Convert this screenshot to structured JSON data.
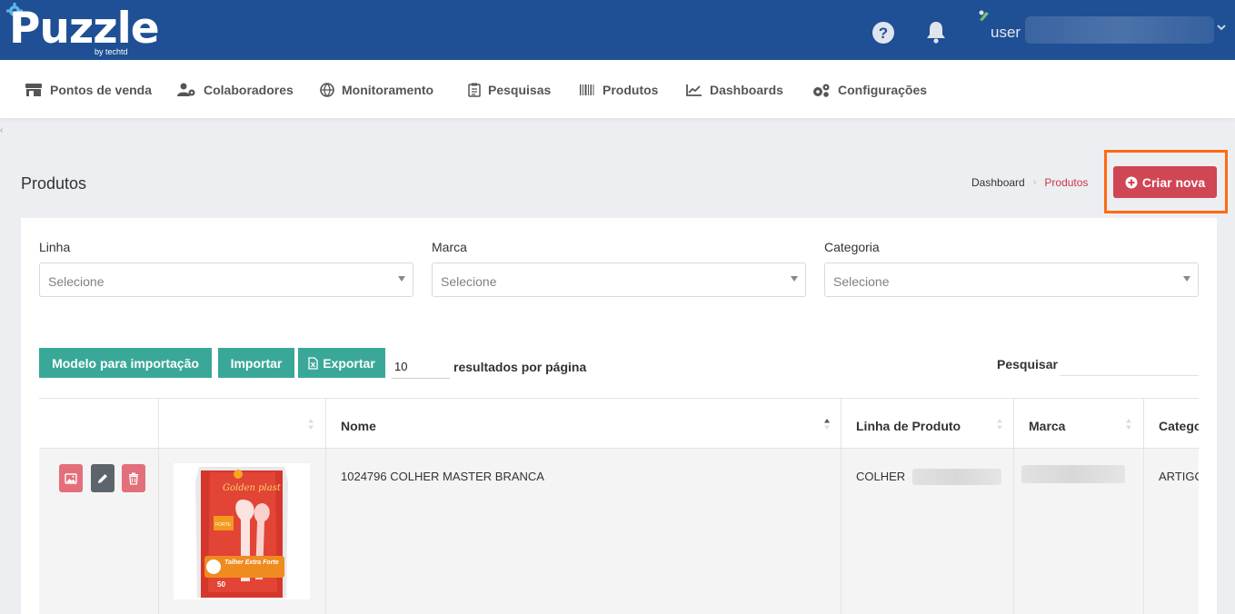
{
  "header": {
    "logo_text": "Puzzle",
    "logo_sub": "by techtd",
    "user_label": "user",
    "colors": {
      "bar": "#1f4f94"
    }
  },
  "nav": {
    "items": [
      {
        "label": "Pontos de venda",
        "icon": "store-icon"
      },
      {
        "label": "Colaboradores",
        "icon": "users-icon"
      },
      {
        "label": "Monitoramento",
        "icon": "globe-icon"
      },
      {
        "label": "Pesquisas",
        "icon": "clipboard-icon"
      },
      {
        "label": "Produtos",
        "icon": "barcode-icon"
      },
      {
        "label": "Dashboards",
        "icon": "chart-line-icon"
      },
      {
        "label": "Configurações",
        "icon": "gears-icon"
      }
    ]
  },
  "page": {
    "title": "Produtos",
    "breadcrumb": {
      "home": "Dashboard",
      "current": "Produtos"
    },
    "create_button": "Criar nova",
    "colors": {
      "accent": "#cf4654",
      "highlight": "#ff6a13",
      "teal": "#3aa898"
    }
  },
  "filters": [
    {
      "label": "Linha",
      "placeholder": "Selecione"
    },
    {
      "label": "Marca",
      "placeholder": "Selecione"
    },
    {
      "label": "Categoria",
      "placeholder": "Selecione"
    }
  ],
  "toolbar": {
    "template_button": "Modelo para importação",
    "import_button": "Importar",
    "export_button": "Exportar",
    "page_length": "10",
    "page_length_label": "resultados por página",
    "search_label": "Pesquisar"
  },
  "table": {
    "columns": [
      "",
      "",
      "Nome",
      "Linha de Produto",
      "Marca",
      "Catego"
    ],
    "rows": [
      {
        "name": "1024796 COLHER MASTER BRANCA",
        "line": "COLHER",
        "category": "ARTIGO",
        "image_text": {
          "brand": "Golden plast",
          "badge": "FORTE",
          "product": "Talher Extra Forte",
          "count": "50"
        }
      }
    ]
  }
}
